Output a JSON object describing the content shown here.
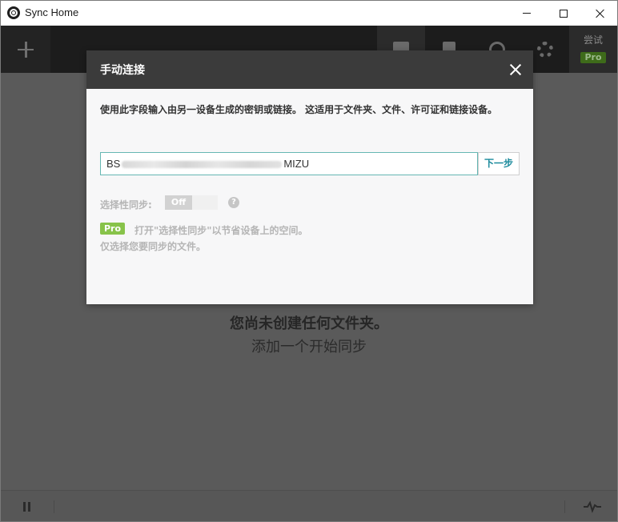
{
  "window": {
    "title": "Sync Home"
  },
  "toolbar": {
    "items": [
      {
        "icon": "folder-icon"
      },
      {
        "icon": "document-icon"
      },
      {
        "icon": "clock-icon"
      },
      {
        "icon": "gear-icon"
      }
    ],
    "trial_label": "尝试",
    "pro_badge": "Pro"
  },
  "empty_state": {
    "title": "您尚未创建任何文件夹。",
    "subtitle": "添加一个开始同步"
  },
  "modal": {
    "title": "手动连接",
    "description": "使用此字段输入由另一设备生成的密钥或链接。 这适用于文件夹、文件、许可证和链接设备。",
    "key_prefix": "BS",
    "key_suffix": "MIZU",
    "next_label": "下一步",
    "selective_sync_label": "选择性同步:",
    "toggle_state": "Off",
    "help_glyph": "?",
    "pro_tag": "Pro",
    "pro_line1": "打开\"选择性同步\"以节省设备上的空间。",
    "pro_line2": "仅选择您要同步的文件。"
  },
  "colors": {
    "accent": "#1a8a9c",
    "input_border": "#66b7b3",
    "pro_green": "#88c34a",
    "toolbar_bg": "#1c1c1c",
    "modal_header_bg": "#3b3b3b"
  }
}
